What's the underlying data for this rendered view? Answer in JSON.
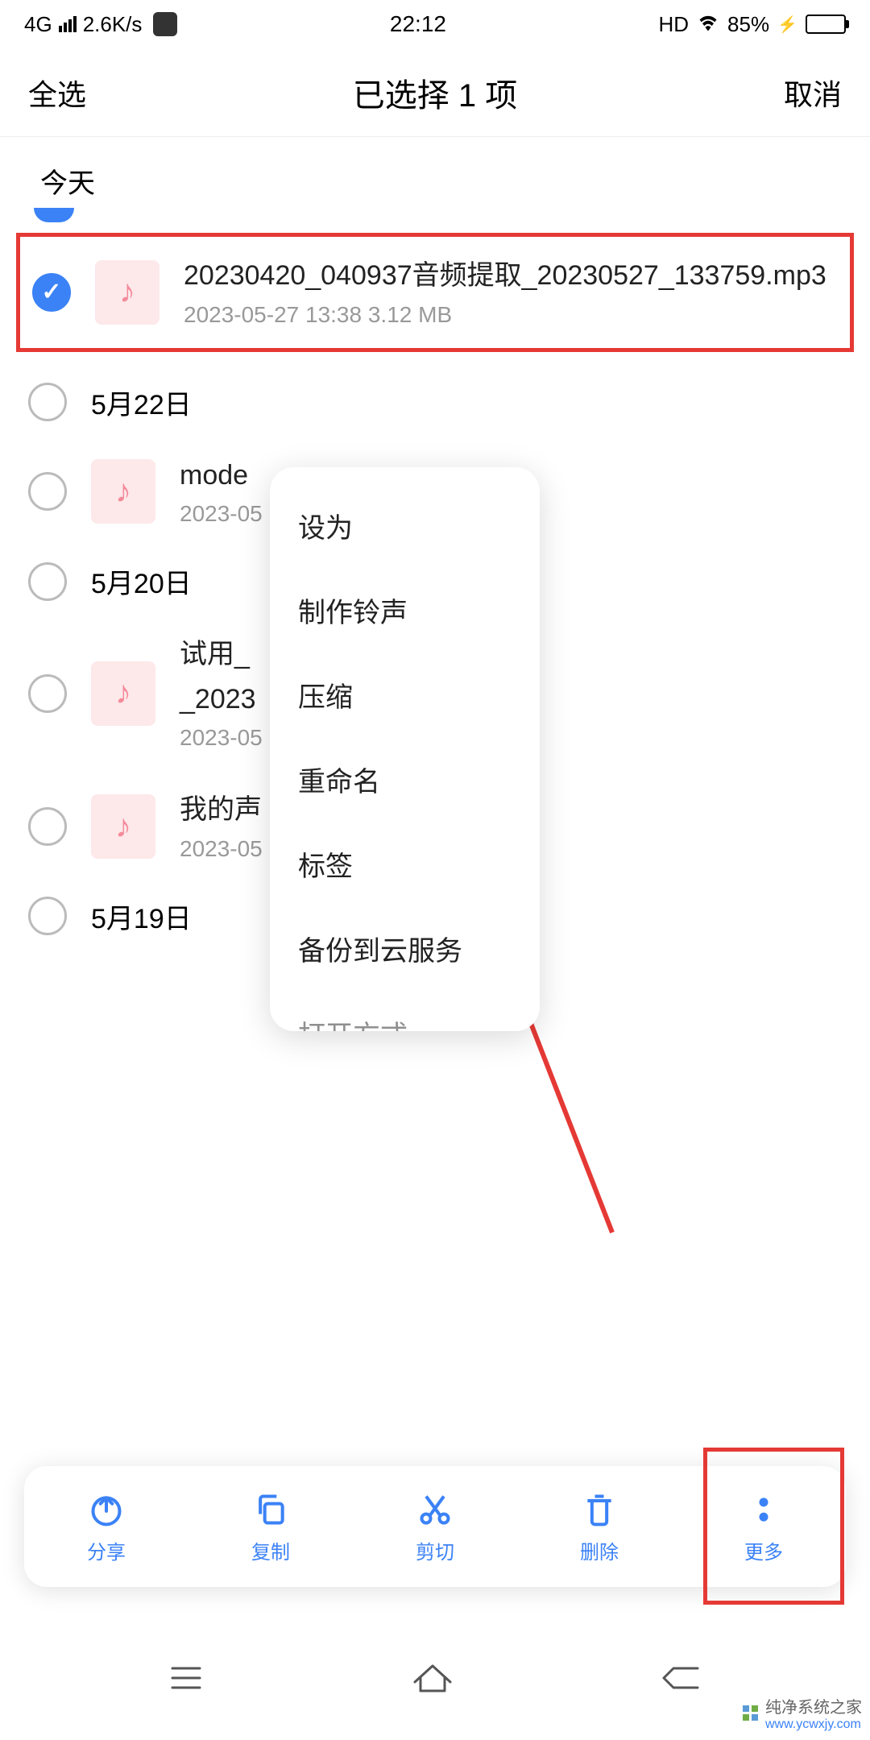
{
  "status": {
    "network": "4G",
    "speed": "2.6K/s",
    "time": "22:12",
    "hd": "HD",
    "battery": "85%"
  },
  "header": {
    "select_all": "全选",
    "title": "已选择 1 项",
    "cancel": "取消"
  },
  "sections": {
    "today": "今天"
  },
  "files": {
    "item1": {
      "name": "20230420_040937音频提取_20230527_133759.mp3",
      "meta": "2023-05-27 13:38   3.12 MB"
    },
    "item2": {
      "name": "mode",
      "meta": "2023-05"
    },
    "item3": {
      "name": "试用_",
      "name2": "_2023",
      "meta": "2023-05"
    },
    "item4": {
      "name": "我的声",
      "meta": "2023-05"
    }
  },
  "dates": {
    "d1": "5月22日",
    "d2": "5月20日",
    "d3": "5月19日"
  },
  "menu": {
    "set_as": "设为",
    "make_ringtone": "制作铃声",
    "compress": "压缩",
    "rename": "重命名",
    "tag": "标签",
    "backup": "备份到云服务",
    "open_with": "打开方式"
  },
  "actions": {
    "share": "分享",
    "copy": "复制",
    "cut": "剪切",
    "delete": "删除",
    "more": "更多"
  },
  "watermark": {
    "name": "纯净系统之家",
    "site": "www.ycwxjy.com"
  }
}
